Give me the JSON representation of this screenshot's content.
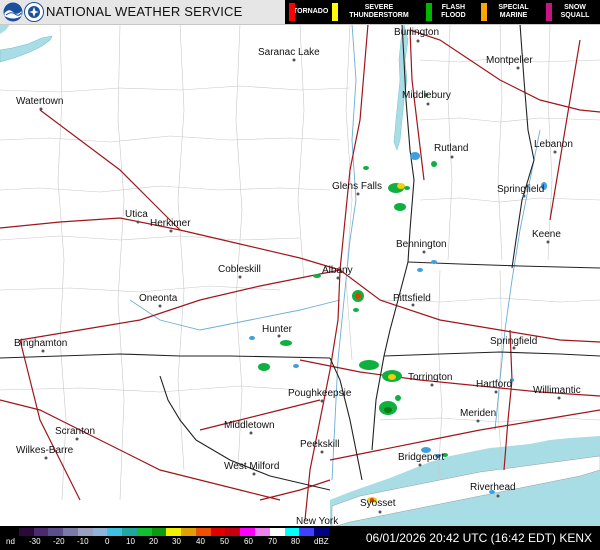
{
  "header": {
    "agency": "NATIONAL WEATHER SERVICE",
    "warnings": [
      {
        "label": "TORNADO",
        "color": "#ff0000"
      },
      {
        "label": "SEVERE THUNDERSTORM",
        "color": "#ffff00"
      },
      {
        "label": "FLASH FLOOD",
        "color": "#00b400"
      },
      {
        "label": "SPECIAL MARINE",
        "color": "#ffa500"
      },
      {
        "label": "SNOW SQUALL",
        "color": "#c71585"
      }
    ]
  },
  "cities": [
    {
      "name": "Burlington"
    },
    {
      "name": "Saranac Lake"
    },
    {
      "name": "Montpelier"
    },
    {
      "name": "Watertown"
    },
    {
      "name": "Middlebury"
    },
    {
      "name": "Rutland"
    },
    {
      "name": "Lebanon"
    },
    {
      "name": "Glens Falls"
    },
    {
      "name": "Springfield"
    },
    {
      "name": "Utica"
    },
    {
      "name": "Herkimer"
    },
    {
      "name": "Keene"
    },
    {
      "name": "Bennington"
    },
    {
      "name": "Cobleskill"
    },
    {
      "name": "Albany"
    },
    {
      "name": "Oneonta"
    },
    {
      "name": "Pittsfield"
    },
    {
      "name": "Hunter"
    },
    {
      "name": "Springfield"
    },
    {
      "name": "Binghamton"
    },
    {
      "name": "Torrington"
    },
    {
      "name": "Hartford"
    },
    {
      "name": "Willimantic"
    },
    {
      "name": "Poughkeepsie"
    },
    {
      "name": "Meriden"
    },
    {
      "name": "Middletown"
    },
    {
      "name": "Scranton"
    },
    {
      "name": "Peekskill"
    },
    {
      "name": "Wilkes-Barre"
    },
    {
      "name": "Bridgeport"
    },
    {
      "name": "West Milford"
    },
    {
      "name": "Riverhead"
    },
    {
      "name": "Syosset"
    },
    {
      "name": "New York"
    }
  ],
  "footer": {
    "scale_labels": [
      "nd",
      "-30",
      "-20",
      "-10",
      "0",
      "10",
      "20",
      "30",
      "40",
      "50",
      "60",
      "70",
      "80",
      "dBZ"
    ],
    "scale_colors": [
      "#000000",
      "#2a0a3a",
      "#4b2a6e",
      "#5a4f88",
      "#7a7aa8",
      "#9aa0c0",
      "#8fb4d8",
      "#3fc0e0",
      "#20a8a0",
      "#10c030",
      "#0e9a10",
      "#f0f000",
      "#e0a000",
      "#f05000",
      "#e00000",
      "#c80010",
      "#ff00ff",
      "#f080f0",
      "#ffffff",
      "#00ffff",
      "#4040ff",
      "#000080"
    ],
    "timestamp": "06/01/2026 20:42 UTC (16:42 EDT) KENX"
  }
}
